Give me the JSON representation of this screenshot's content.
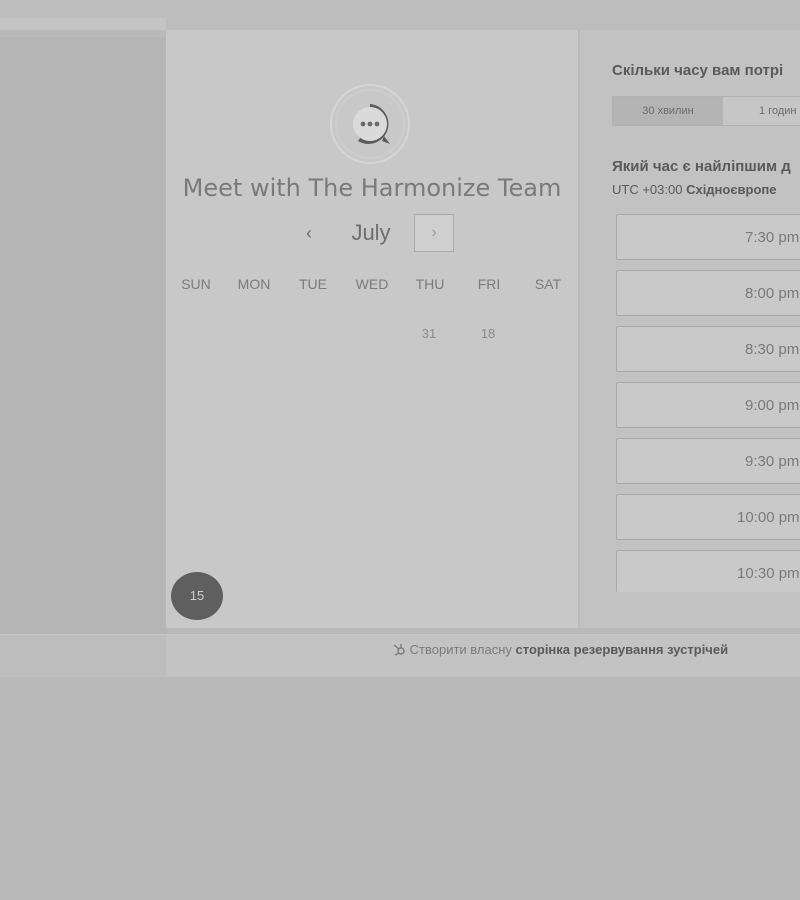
{
  "colors": {
    "background": "#b9b9b9",
    "card": "#c8c8c8",
    "today_badge": "#5f5f5f"
  },
  "calendar": {
    "title": "Meet with The Harmonize Team",
    "logo_icon": "chat-bubble-icon",
    "prev_icon": "‹",
    "next_icon": "›",
    "month": "July",
    "weekdays": [
      "SUN",
      "MON",
      "TUE",
      "WED",
      "THU",
      "FRI",
      "SAT"
    ],
    "days": [
      {
        "label": "31",
        "weekday": "THU"
      },
      {
        "label": "18",
        "weekday": "FRI"
      }
    ],
    "today": "15"
  },
  "scheduler": {
    "duration_question": "Скільки часу вам потрі",
    "duration_options": [
      "30 хвилин",
      "1 годин"
    ],
    "selected_duration": "30 хвилин",
    "time_question": "Який час є найліпшим д",
    "timezone_prefix": "UTC +03:00",
    "timezone_name": "Східноєвропе",
    "slots": [
      "7:30 pm",
      "8:00 pm",
      "8:30 pm",
      "9:00 pm",
      "9:30 pm",
      "10:00 pm",
      "10:30 pm"
    ]
  },
  "footer": {
    "icon": "hubspot-sprocket-icon",
    "prefix": "Створити власну",
    "bold": "сторінка резервування зустрічей"
  }
}
